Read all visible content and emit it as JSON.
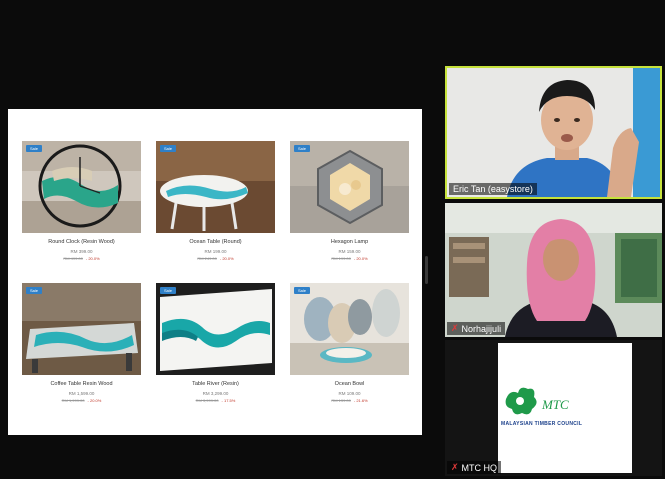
{
  "shared_screen": {
    "products": [
      {
        "name": "Round Clock (Resin Wood)",
        "badge": "Sale",
        "price": "RM 399.00",
        "old_price": "RM 499.00",
        "save": "- 20.0%"
      },
      {
        "name": "Ocean Table (Round)",
        "badge": "Sale",
        "price": "RM 199.00",
        "old_price": "RM 249.00",
        "save": "- 20.0%"
      },
      {
        "name": "Hexagon Lamp",
        "badge": "Sale",
        "price": "RM 159.00",
        "old_price": "RM 199.00",
        "save": "- 20.0%"
      },
      {
        "name": "Coffee Table Resin Wood",
        "badge": "Sale",
        "price": "RM 1,599.00",
        "old_price": "RM 1,999.00",
        "save": "- 20.0%"
      },
      {
        "name": "Table River (Resin)",
        "badge": "Sale",
        "price": "RM 3,299.00",
        "old_price": "RM 3,999.00",
        "save": "- 17.5%"
      },
      {
        "name": "Ocean Bowl",
        "badge": "Sale",
        "price": "RM 109.00",
        "old_price": "RM 139.00",
        "save": "- 21.6%"
      }
    ]
  },
  "participants": {
    "eric": {
      "name": "Eric Tan (easystore)"
    },
    "noor": {
      "name": "Norhajijuli"
    },
    "mtc": {
      "name": "MTC HQ",
      "logo_line1": "MTC",
      "logo_line2": "MALAYSIAN TIMBER COUNCIL"
    }
  },
  "colors": {
    "active_speaker_border": "#c6e23b",
    "badge": "#2f80c8",
    "mtc_green": "#1f9a4a",
    "mtc_blue": "#1a3f8a"
  }
}
